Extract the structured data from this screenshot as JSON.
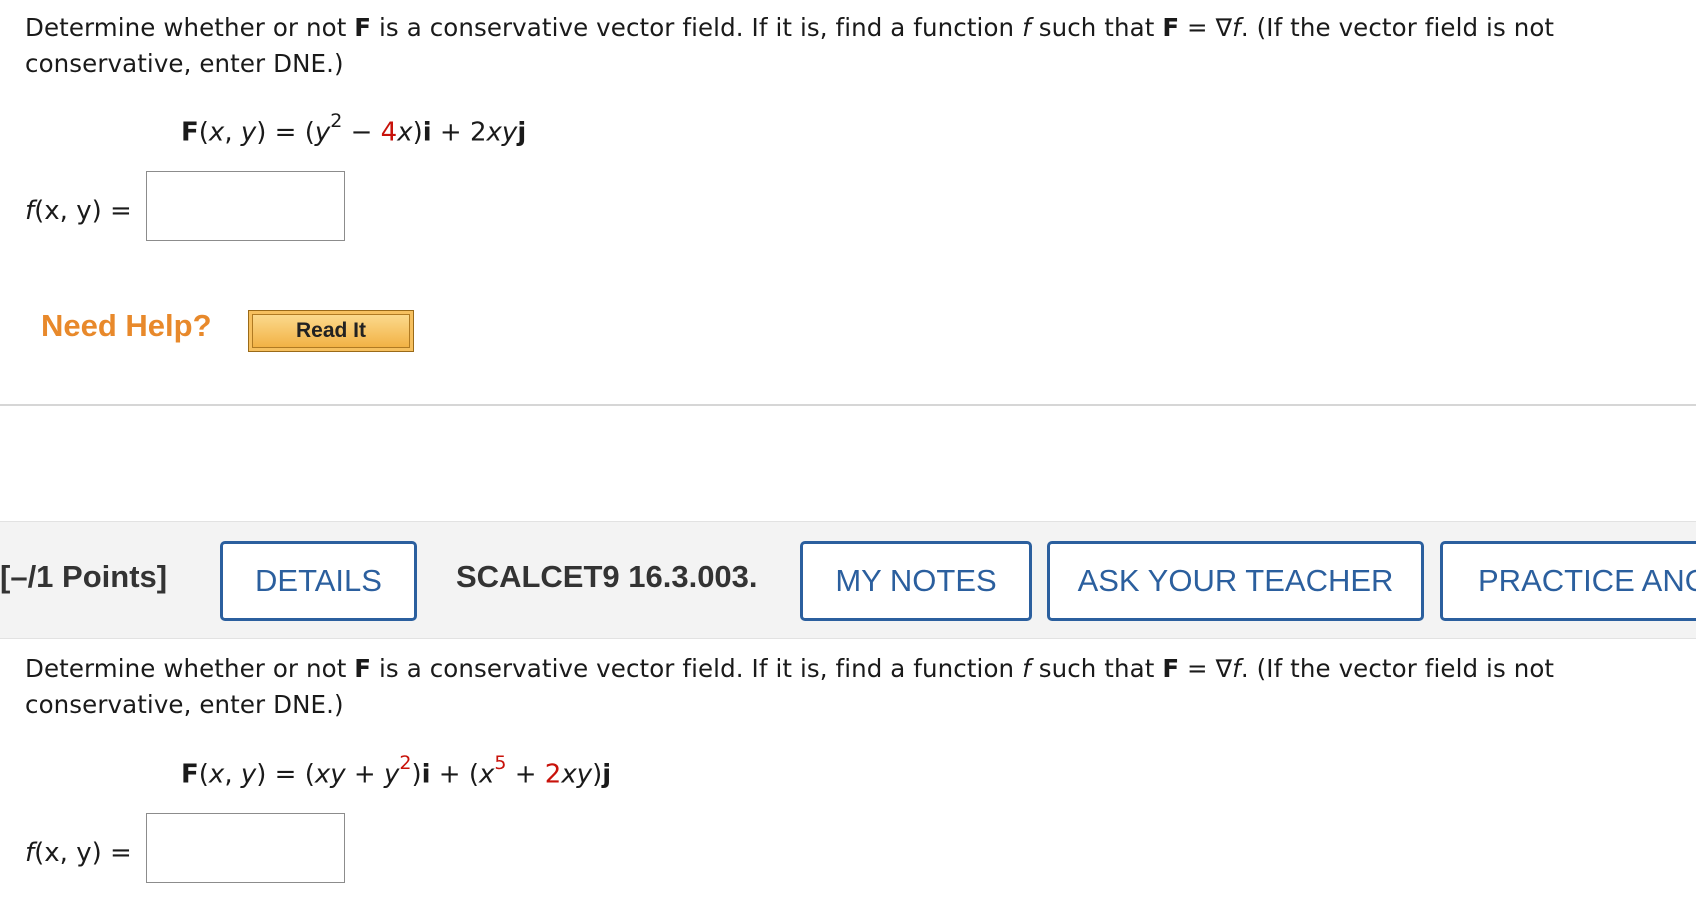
{
  "question1": {
    "prompt": {
      "part1": "Determine whether or not ",
      "F": "F",
      "part2": " is a conservative vector field. If it is, find a function ",
      "f": "f",
      "part3": " such that ",
      "F2": "F",
      "part4": " = ∇",
      "f2": "f",
      "part5": ". (If the vector field is not conservative, enter DNE.)"
    },
    "formula": {
      "F": "F",
      "args": "(",
      "x": "x",
      "comma": ", ",
      "y": "y",
      "eq": ") = (",
      "y2": "y",
      "exp": "2",
      "minus": " − ",
      "coef": "4",
      "x2": "x",
      "close": ")",
      "i": "i",
      "plus": " + 2",
      "xy": "xy",
      "j": "j"
    },
    "answer_label": {
      "f": "f",
      "args": "(x, y)",
      "eq": " ="
    },
    "answer_value": "",
    "need_help": "Need Help?",
    "read_it": "Read It"
  },
  "question2": {
    "points": "[–/1 Points]",
    "details": "DETAILS",
    "id": "SCALCET9 16.3.003.",
    "my_notes": "MY NOTES",
    "ask_teacher": "ASK YOUR TEACHER",
    "practice": "PRACTICE ANOTHER",
    "prompt": {
      "part1": "Determine whether or not ",
      "F": "F",
      "part2": " is a conservative vector field. If it is, find a function ",
      "f": "f",
      "part3": " such that ",
      "F2": "F",
      "part4": " = ∇",
      "f2": "f",
      "part5": ". (If the vector field is not conservative, enter DNE.)"
    },
    "formula": {
      "F": "F",
      "args": "(",
      "x": "x",
      "comma": ", ",
      "y": "y",
      "eq": ") = (",
      "term1": "xy",
      "plus1": " + ",
      "y2": "y",
      "exp1": "2",
      "close1": ")",
      "i": "i",
      "plus2": " + (",
      "x2": "x",
      "exp2": "5",
      "plus3": " + ",
      "coef": "2",
      "term2": "xy",
      "close2": ")",
      "j": "j"
    },
    "answer_label": {
      "f": "f",
      "args": "(x, y)",
      "eq": " ="
    },
    "answer_value": ""
  },
  "colors": {
    "accent_blue": "#2b5f9e",
    "help_orange": "#e8892b",
    "randomized_red": "#c8120a",
    "header_bg": "#f3f3f3"
  }
}
